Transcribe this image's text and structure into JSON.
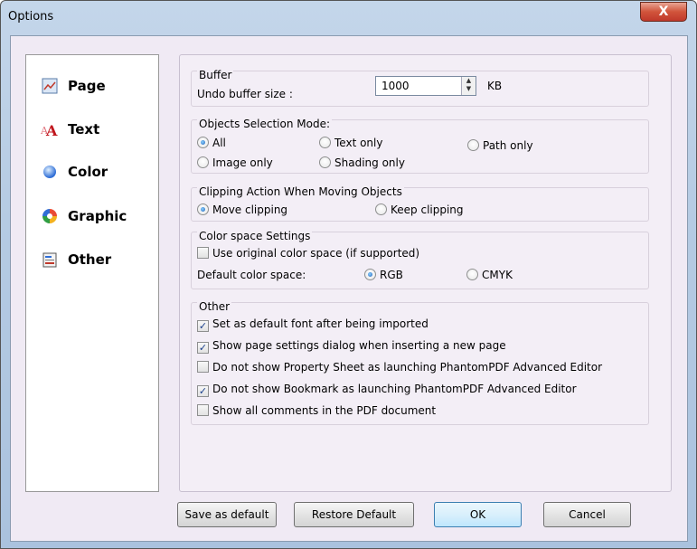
{
  "window": {
    "title": "Options",
    "close_glyph": "X"
  },
  "nav": {
    "items": [
      {
        "label": "Page",
        "icon": "page-icon"
      },
      {
        "label": "Text",
        "icon": "text-icon"
      },
      {
        "label": "Color",
        "icon": "color-icon"
      },
      {
        "label": "Graphic",
        "icon": "graphic-icon"
      },
      {
        "label": "Other",
        "icon": "other-icon"
      }
    ]
  },
  "buffer": {
    "title": "Buffer",
    "undo_label": "Undo buffer size :",
    "undo_value": "1000",
    "unit": "KB"
  },
  "selection_mode": {
    "title": "Objects Selection Mode:",
    "options": [
      {
        "label": "All",
        "selected": true
      },
      {
        "label": "Text only",
        "selected": false
      },
      {
        "label": "Path only",
        "selected": false
      },
      {
        "label": "Image only",
        "selected": false
      },
      {
        "label": "Shading only",
        "selected": false
      }
    ]
  },
  "clipping": {
    "title": "Clipping Action When Moving Objects",
    "options": [
      {
        "label": "Move clipping",
        "selected": true
      },
      {
        "label": "Keep clipping",
        "selected": false
      }
    ]
  },
  "color_space": {
    "title": "Color space Settings",
    "use_original_label": "Use original color space (if supported)",
    "use_original_checked": false,
    "default_label": "Default color space:",
    "options": [
      {
        "label": "RGB",
        "selected": true
      },
      {
        "label": "CMYK",
        "selected": false
      }
    ]
  },
  "other": {
    "title": "Other",
    "checkboxes": [
      {
        "label": "Set as default font after being imported",
        "checked": true
      },
      {
        "label": "Show page settings dialog when inserting a new page",
        "checked": true
      },
      {
        "label": "Do not show Property Sheet as launching PhantomPDF Advanced Editor",
        "checked": false
      },
      {
        "label": "Do not show Bookmark as launching PhantomPDF Advanced Editor",
        "checked": true
      },
      {
        "label": "Show all comments in the PDF document",
        "checked": false
      }
    ]
  },
  "buttons": {
    "save_default": "Save as default",
    "restore_default": "Restore Default",
    "ok": "OK",
    "cancel": "Cancel"
  },
  "colors": {
    "accent": "#1f5fb8",
    "close_button": "#c0392b",
    "client_background": "#f0eaf4"
  }
}
